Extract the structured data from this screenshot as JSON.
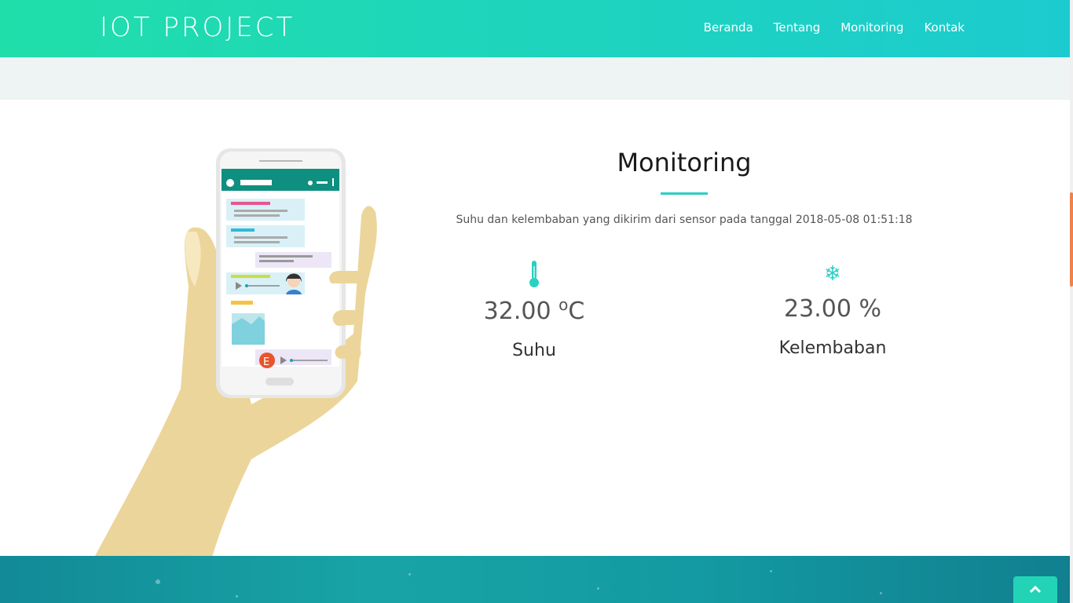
{
  "header": {
    "brand": "IOT PROJECT",
    "nav": [
      "Beranda",
      "Tentang",
      "Monitoring",
      "Kontak"
    ]
  },
  "monitoring": {
    "title": "Monitoring",
    "subtitle": "Suhu dan kelembaban yang dikirim dari sensor pada tanggal 2018-05-08 01:51:18",
    "temperature": {
      "icon": "thermometer-icon",
      "value": "32.00",
      "unit_symbol": "o",
      "unit_letter": "C",
      "label": "Suhu"
    },
    "humidity": {
      "icon": "snowflake-icon",
      "value": "23.00 %",
      "label": "Kelembaban"
    }
  },
  "phone_illustration": {
    "chat_avatar_letter": "E"
  },
  "colors": {
    "accent": "#29d0c2",
    "header_start": "#20deaa",
    "header_end": "#1ccbcf",
    "footer": "#139aa2",
    "scroll_thumb": "#f0814a"
  }
}
